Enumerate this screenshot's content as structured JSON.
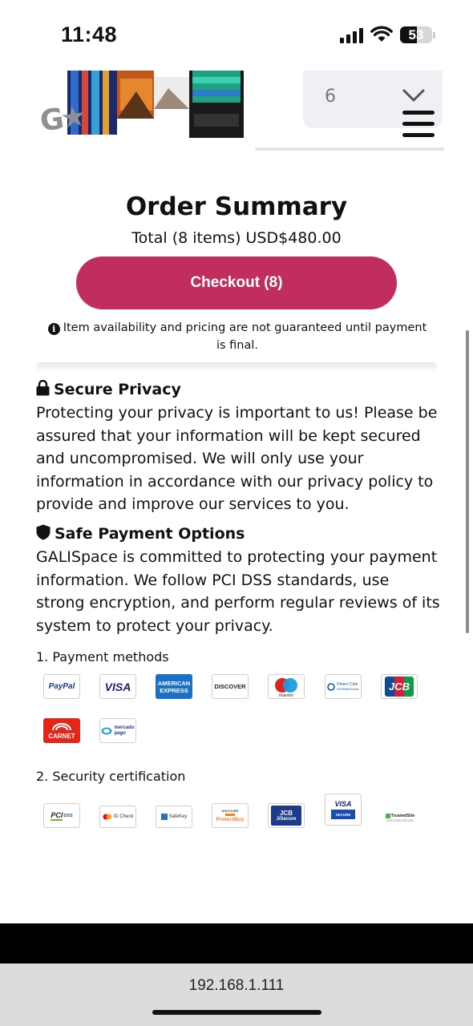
{
  "status_bar": {
    "time": "11:48",
    "battery": "53",
    "battery_level": 0.53
  },
  "product": {
    "quantity": "6",
    "badge": "G★"
  },
  "order_summary": {
    "title": "Order Summary",
    "total": "Total (8 items) USD$480.00",
    "checkout_label": "Checkout (8)",
    "notice": "Item availability and pricing are not guaranteed until payment is final."
  },
  "secure_privacy": {
    "heading": "Secure Privacy",
    "text": "Protecting your privacy is important to us! Please be assured that your information will be kept secured and uncompromised. We will only use your information in accordance with our privacy policy to provide and improve our services to you."
  },
  "safe_payment": {
    "heading": "Safe Payment Options",
    "text": "GALISpace is committed to protecting your payment information. We follow PCI DSS standards, use strong encryption, and perform regular reviews of its system to protect your privacy."
  },
  "payment_methods": {
    "label": "1. Payment methods",
    "logos": {
      "paypal": "PayPal",
      "visa": "VISA",
      "amex_1": "AMERICAN",
      "amex_2": "EXPRESS",
      "discover": "DISCOVER",
      "maestro": "maestro",
      "diners_1": "Diners Club",
      "diners_2": "INTERNATIONAL",
      "jcb": "JCB",
      "carnet": "CARNET",
      "mercado_1": "mercado",
      "mercado_2": "pago"
    }
  },
  "security_certification": {
    "label": "2. Security certification",
    "logos": {
      "pci": "PCI",
      "pci_dss": "DSS",
      "idcheck": "ID Check",
      "safekey": "SafeKey",
      "protectbuy_top": "DISCOVER",
      "protectbuy": "ProtectBuy",
      "jsecure_1": "JCB",
      "jsecure_2": "J/Secure",
      "visa_secure_1": "VISA",
      "visa_secure_2": "SECURE",
      "trustedsite_1": "TrustedSite",
      "trustedsite_2": "CERTIFIED SECURE"
    }
  },
  "browser": {
    "url": "192.168.1.111"
  },
  "colors": {
    "accent": "#c12d5c",
    "field_bg": "#eef0f3",
    "url_bar": "#dcdcdc"
  }
}
